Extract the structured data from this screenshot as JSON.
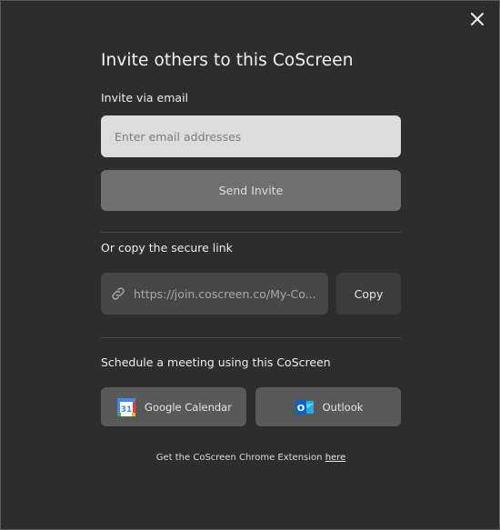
{
  "dialog": {
    "title": "Invite others to this CoScreen",
    "close_icon": "close-icon"
  },
  "email_section": {
    "label": "Invite via email",
    "placeholder": "Enter email addresses",
    "value": "",
    "send_button": "Send Invite"
  },
  "link_section": {
    "label": "Or copy the secure link",
    "url": "https://join.coscreen.co/My-Co...",
    "link_icon": "link-icon",
    "copy_button": "Copy"
  },
  "schedule_section": {
    "label": "Schedule a meeting using this CoScreen",
    "google_calendar": {
      "label": "Google Calendar",
      "icon": "google-calendar-icon",
      "icon_text": "31"
    },
    "outlook": {
      "label": "Outlook",
      "icon": "outlook-icon",
      "icon_text": "O"
    }
  },
  "footer": {
    "text": "Get the CoScreen Chrome Extension ",
    "link": "here"
  },
  "colors": {
    "background": "#2d2d2d",
    "input_bg": "#dcdcdc",
    "send_button_bg": "#707070",
    "link_box_bg": "#474747",
    "copy_button_bg": "#3c3c3c",
    "calendar_button_bg": "#595959"
  }
}
